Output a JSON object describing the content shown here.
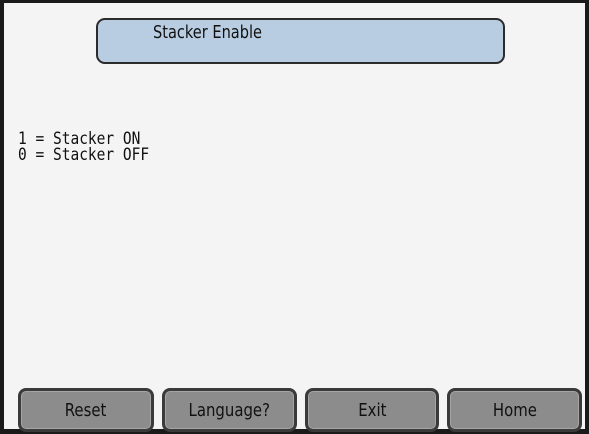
{
  "screen": {
    "title": "Stacker Enable",
    "help_lines": [
      "1 = Stacker ON",
      "0 = Stacker OFF"
    ]
  },
  "buttons": {
    "reset": "Reset",
    "language": "Language?",
    "exit": "Exit",
    "home": "Home"
  },
  "colors": {
    "title_fill": "#b9cde2",
    "button_fill": "#8c8c8c",
    "background": "#f4f4f4"
  }
}
